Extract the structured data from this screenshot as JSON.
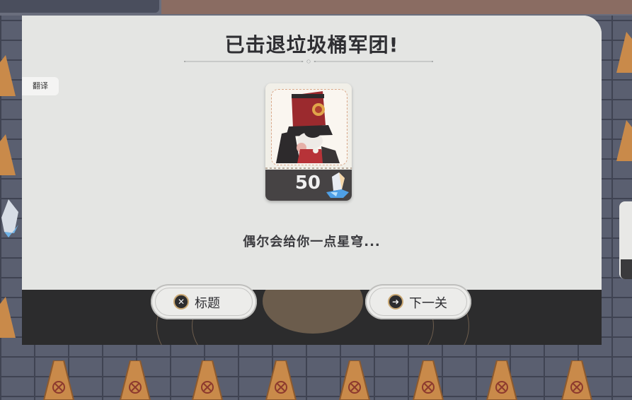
{
  "dialog": {
    "title": "已击退垃圾桶军团!",
    "message": "偶尔会给你一点星穹...",
    "translate_label": "翻译"
  },
  "reward": {
    "count": "50",
    "currency_icon": "stellar-jade-crystal-icon"
  },
  "buttons": {
    "title_label": "标题",
    "title_icon": "close-x-icon",
    "next_label": "下一关",
    "next_icon": "arrow-right-icon"
  },
  "colors": {
    "panel": "#e4e5e3",
    "bottom_bar": "#2c2c2d",
    "accent_gold": "#c9a772",
    "text_dark": "#2f2f33"
  }
}
